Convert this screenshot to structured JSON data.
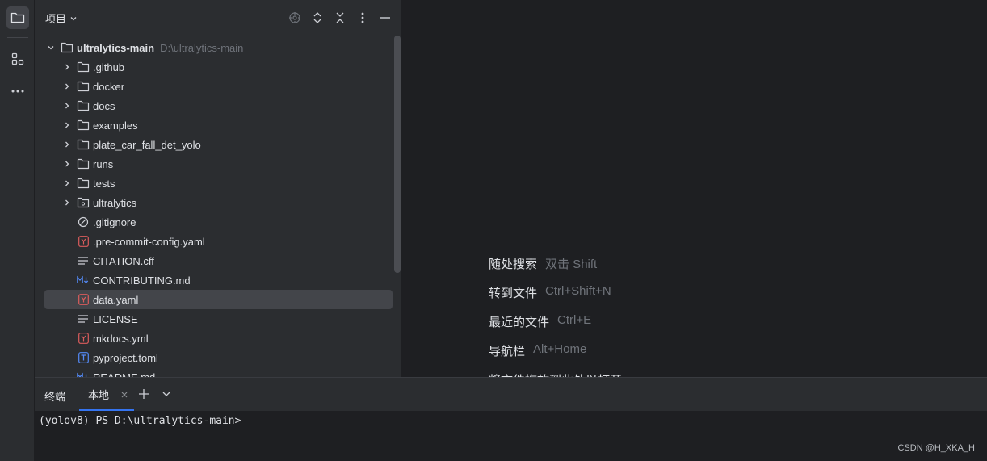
{
  "project_panel": {
    "title": "项目",
    "tree": [
      {
        "name": "ultralytics-main",
        "hint": "D:\\ultralytics-main",
        "kind": "folder",
        "level": 0,
        "expanded": true
      },
      {
        "name": ".github",
        "kind": "folder",
        "level": 1
      },
      {
        "name": "docker",
        "kind": "folder",
        "level": 1
      },
      {
        "name": "docs",
        "kind": "folder",
        "level": 1
      },
      {
        "name": "examples",
        "kind": "folder",
        "level": 1
      },
      {
        "name": "plate_car_fall_det_yolo",
        "kind": "folder",
        "level": 1
      },
      {
        "name": "runs",
        "kind": "folder",
        "level": 1
      },
      {
        "name": "tests",
        "kind": "folder",
        "level": 1
      },
      {
        "name": "ultralytics",
        "kind": "package",
        "level": 1
      },
      {
        "name": ".gitignore",
        "kind": "ignore",
        "level": 1
      },
      {
        "name": ".pre-commit-config.yaml",
        "kind": "yaml",
        "level": 1
      },
      {
        "name": "CITATION.cff",
        "kind": "text",
        "level": 1
      },
      {
        "name": "CONTRIBUTING.md",
        "kind": "markdown",
        "level": 1
      },
      {
        "name": "data.yaml",
        "kind": "yaml",
        "level": 1,
        "selected": true
      },
      {
        "name": "LICENSE",
        "kind": "text",
        "level": 1
      },
      {
        "name": "mkdocs.yml",
        "kind": "yaml",
        "level": 1
      },
      {
        "name": "pyproject.toml",
        "kind": "toml",
        "level": 1
      },
      {
        "name": "README.md",
        "kind": "markdown",
        "level": 1
      }
    ]
  },
  "editor_tips": [
    {
      "label": "随处搜索",
      "shortcut": "双击 Shift"
    },
    {
      "label": "转到文件",
      "shortcut": "Ctrl+Shift+N"
    },
    {
      "label": "最近的文件",
      "shortcut": "Ctrl+E"
    },
    {
      "label": "导航栏",
      "shortcut": "Alt+Home"
    },
    {
      "label": "将文件拖放到此处以打开",
      "shortcut": ""
    }
  ],
  "terminal": {
    "title": "终端",
    "tab_label": "本地",
    "prompt": "(yolov8) PS D:\\ultralytics-main>"
  },
  "watermark": "CSDN @H_XKA_H",
  "colors": {
    "panel_bg": "#2b2d30",
    "editor_bg": "#1e1f22",
    "selection": "#43454a",
    "accent": "#3574f0",
    "yaml_icon": "#db5c5c",
    "markdown_icon": "#548af7",
    "toml_icon": "#548af7"
  }
}
